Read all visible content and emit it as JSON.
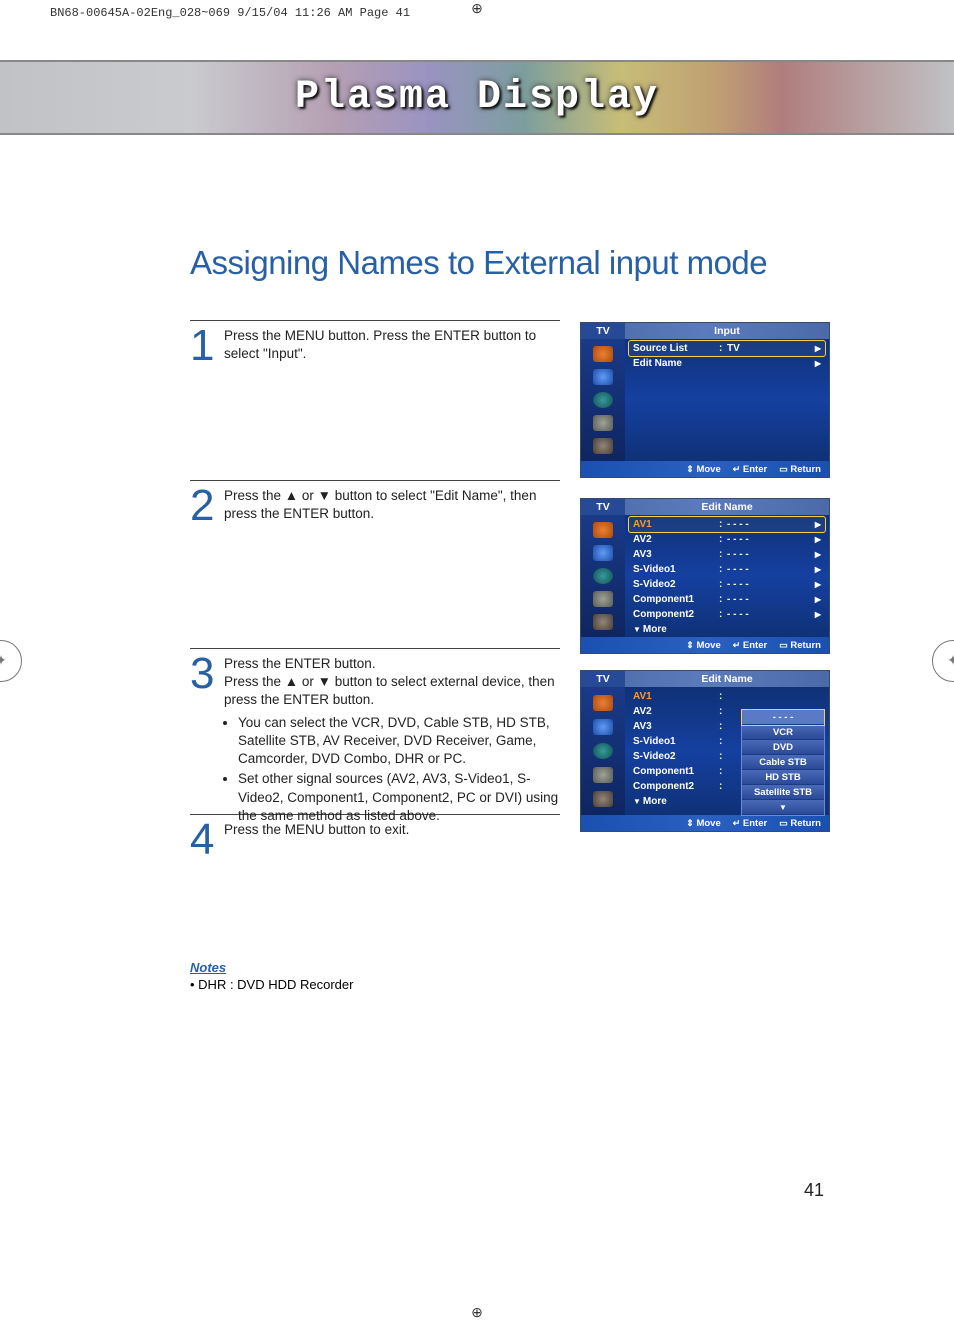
{
  "print_mark": "BN68-00645A-02Eng_028~069  9/15/04  11:26 AM  Page 41",
  "banner_title": "Plasma Display",
  "page_title": "Assigning Names to External input mode",
  "page_number": "41",
  "steps": [
    {
      "num": "1",
      "text": "Press the MENU button. Press the ENTER button to select \"Input\"."
    },
    {
      "num": "2",
      "text": "Press the ▲ or ▼ button to select \"Edit Name\", then press the ENTER button."
    },
    {
      "num": "3",
      "text": "Press the ENTER button.\nPress the ▲ or ▼ button to select external device, then press the ENTER button.",
      "bullets": [
        "You can select the VCR, DVD, Cable STB, HD STB, Satellite STB, AV Receiver, DVD Receiver, Game, Camcorder, DVD Combo, DHR or PC.",
        "Set other signal sources (AV2, AV3, S-Video1, S-Video2, Component1, Component2, PC or DVI) using the same method as listed above."
      ]
    },
    {
      "num": "4",
      "text": "Press the MENU button to exit."
    }
  ],
  "notes_title": "Notes",
  "notes_items": [
    "DHR : DVD HDD Recorder"
  ],
  "osd_common": {
    "tv": "TV",
    "footer_move": "Move",
    "footer_enter": "Enter",
    "footer_return": "Return"
  },
  "osd1": {
    "title": "Input",
    "rows": [
      {
        "label": "Source List",
        "value": "TV",
        "sel": true,
        "arrow": true
      },
      {
        "label": "Edit Name",
        "value": "",
        "sel": false,
        "arrow": true
      }
    ]
  },
  "osd2": {
    "title": "Edit Name",
    "rows": [
      {
        "label": "AV1",
        "value": "- - - -",
        "sel": true,
        "arrow": true,
        "orange": true
      },
      {
        "label": "AV2",
        "value": "- - - -",
        "arrow": true
      },
      {
        "label": "AV3",
        "value": "- - - -",
        "arrow": true
      },
      {
        "label": "S-Video1",
        "value": "- - - -",
        "arrow": true
      },
      {
        "label": "S-Video2",
        "value": "- - - -",
        "arrow": true
      },
      {
        "label": "Component1",
        "value": "- - - -",
        "arrow": true
      },
      {
        "label": "Component2",
        "value": "- - - -",
        "arrow": true
      }
    ],
    "more": "More"
  },
  "osd3": {
    "title": "Edit Name",
    "rows": [
      {
        "label": "AV1",
        "orange": true
      },
      {
        "label": "AV2"
      },
      {
        "label": "AV3"
      },
      {
        "label": "S-Video1"
      },
      {
        "label": "S-Video2"
      },
      {
        "label": "Component1"
      },
      {
        "label": "Component2"
      }
    ],
    "more": "More",
    "dropdown": [
      "- - - -",
      "VCR",
      "DVD",
      "Cable STB",
      "HD STB",
      "Satellite STB",
      "▼"
    ]
  }
}
